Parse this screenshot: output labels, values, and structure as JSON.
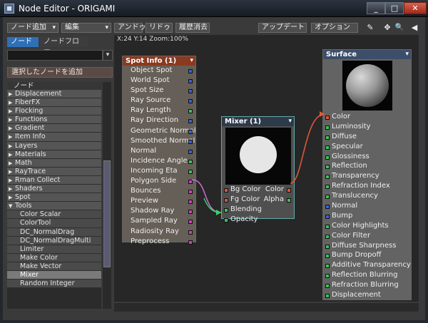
{
  "window": {
    "title": "Node Editor - ORIGAMI",
    "min_label": "_",
    "max_label": "□",
    "close_label": "✕"
  },
  "toolbar": {
    "add_node": "ノード追加",
    "edit": "編集",
    "undo": "アンドゥ",
    "redo": "リドゥ",
    "clear_history": "履歴消去",
    "update": "アップデート",
    "options": "オプション",
    "pen_icon": "✎",
    "move_icon": "✥",
    "zoom_icon": "🔍",
    "collapse_icon": "◀"
  },
  "left": {
    "tab_nodes": "ノード",
    "tab_nodeflow": "ノードフロー",
    "combo_arrow": "▾",
    "add_selected": "選択したノードを追加",
    "list_header": "ノード",
    "items": [
      {
        "label": "Displacement",
        "arrow": "▶"
      },
      {
        "label": "FiberFX",
        "arrow": "▶"
      },
      {
        "label": "Flocking",
        "arrow": "▶"
      },
      {
        "label": "Functions",
        "arrow": "▶"
      },
      {
        "label": "Gradient",
        "arrow": "▶"
      },
      {
        "label": "Item Info",
        "arrow": "▶"
      },
      {
        "label": "Layers",
        "arrow": "▶"
      },
      {
        "label": "Materials",
        "arrow": "▶"
      },
      {
        "label": "Math",
        "arrow": "▶"
      },
      {
        "label": "RayTrace",
        "arrow": "▶"
      },
      {
        "label": "Rman Collect",
        "arrow": "▶"
      },
      {
        "label": "Shaders",
        "arrow": "▶"
      },
      {
        "label": "Spot",
        "arrow": "▶"
      },
      {
        "label": "Tools",
        "arrow": "▼"
      }
    ],
    "children": [
      "Color Scalar",
      "ColorTool",
      "DC_NormalDrag",
      "DC_NormalDragMulti",
      "Limiter",
      "Make Color",
      "Make Vector",
      "Mixer",
      "Random Integer"
    ]
  },
  "canvas": {
    "coords": "X:24 Y:14 Zoom:100%"
  },
  "spot_node": {
    "title": "Spot Info (1)",
    "dropdown": "▾",
    "ports": [
      {
        "label": "Object Spot",
        "color": "#3b63d6"
      },
      {
        "label": "World Spot",
        "color": "#3b63d6"
      },
      {
        "label": "Spot Size",
        "color": "#3b63d6"
      },
      {
        "label": "Ray Source",
        "color": "#3b63d6"
      },
      {
        "label": "Ray Length",
        "color": "#3fc05a"
      },
      {
        "label": "Ray Direction",
        "color": "#3b63d6"
      },
      {
        "label": "Geometric Normal",
        "color": "#3b63d6"
      },
      {
        "label": "Smoothed Normal",
        "color": "#3b63d6"
      },
      {
        "label": "Normal",
        "color": "#3b63d6"
      },
      {
        "label": "Incidence Angle",
        "color": "#3fc05a"
      },
      {
        "label": "Incoming Eta",
        "color": "#3fc05a"
      },
      {
        "label": "Polygon Side",
        "color": "#d040c0"
      },
      {
        "label": "Bounces",
        "color": "#d040c0"
      },
      {
        "label": "Preview",
        "color": "#d040c0"
      },
      {
        "label": "Shadow Ray",
        "color": "#d040c0"
      },
      {
        "label": "Sampled Ray",
        "color": "#d040c0"
      },
      {
        "label": "Radiosity Ray",
        "color": "#d040c0"
      },
      {
        "label": "Preprocess",
        "color": "#d040c0"
      }
    ]
  },
  "mixer_node": {
    "title": "Mixer (1)",
    "dropdown": "▾",
    "inputs": [
      {
        "label": "Bg Color",
        "color": "#e0553a"
      },
      {
        "label": "Fg Color",
        "color": "#e0553a"
      },
      {
        "label": "Blending",
        "color": "#3fc05a"
      },
      {
        "label": "Opacity",
        "color": "#3fc05a"
      }
    ],
    "outputs": [
      {
        "label": "Color",
        "color": "#e0553a"
      },
      {
        "label": "Alpha",
        "color": "#3fc05a"
      }
    ]
  },
  "surface_node": {
    "title": "Surface",
    "dropdown": "▾",
    "inputs": [
      {
        "label": "Color",
        "color": "#e0553a"
      },
      {
        "label": "Luminosity",
        "color": "#3fc05a"
      },
      {
        "label": "Diffuse",
        "color": "#3fc05a"
      },
      {
        "label": "Specular",
        "color": "#3fc05a"
      },
      {
        "label": "Glossiness",
        "color": "#3fc05a"
      },
      {
        "label": "Reflection",
        "color": "#3fc05a"
      },
      {
        "label": "Transparency",
        "color": "#3fc05a"
      },
      {
        "label": "Refraction Index",
        "color": "#3fc05a"
      },
      {
        "label": "Translucency",
        "color": "#3fc05a"
      },
      {
        "label": "Normal",
        "color": "#3b63d6"
      },
      {
        "label": "Bump",
        "color": "#3b63d6"
      },
      {
        "label": "Color Highlights",
        "color": "#3fc05a"
      },
      {
        "label": "Color Filter",
        "color": "#3fc05a"
      },
      {
        "label": "Diffuse Sharpness",
        "color": "#3fc05a"
      },
      {
        "label": "Bump Dropoff",
        "color": "#3fc05a"
      },
      {
        "label": "Additive Transparency",
        "color": "#3fc05a"
      },
      {
        "label": "Reflection Blurring",
        "color": "#3fc05a"
      },
      {
        "label": "Refraction Blurring",
        "color": "#3fc05a"
      },
      {
        "label": "Displacement",
        "color": "#3fc05a"
      }
    ]
  }
}
